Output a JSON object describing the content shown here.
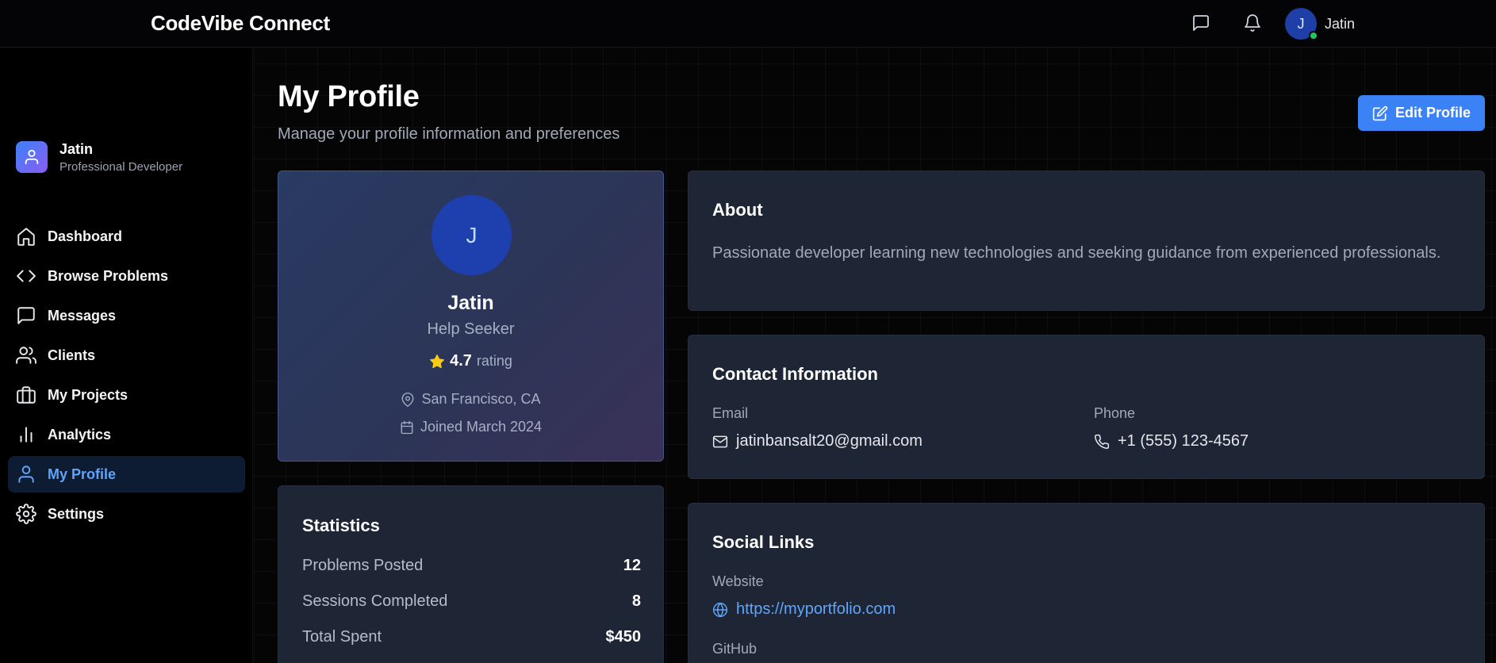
{
  "header": {
    "brand": "CodeVibe Connect",
    "avatar_initial": "J",
    "username": "Jatin",
    "icons": [
      "message-square-icon",
      "bell-icon"
    ]
  },
  "sidebar": {
    "user": {
      "name": "Jatin",
      "role": "Professional Developer"
    },
    "items": [
      {
        "label": "Dashboard",
        "icon": "home-icon"
      },
      {
        "label": "Browse Problems",
        "icon": "code-icon"
      },
      {
        "label": "Messages",
        "icon": "message-square-icon"
      },
      {
        "label": "Clients",
        "icon": "users-icon"
      },
      {
        "label": "My Projects",
        "icon": "briefcase-icon"
      },
      {
        "label": "Analytics",
        "icon": "bar-chart-icon"
      },
      {
        "label": "My Profile",
        "icon": "user-icon",
        "active": true
      },
      {
        "label": "Settings",
        "icon": "settings-icon"
      }
    ]
  },
  "main": {
    "title": "My Profile",
    "subtitle": "Manage your profile information and preferences",
    "edit_button": "Edit Profile"
  },
  "profile_card": {
    "initial": "J",
    "name": "Jatin",
    "role": "Help Seeker",
    "rating_value": "4.7",
    "rating_label": "rating",
    "location": "San Francisco, CA",
    "joined": "Joined March 2024"
  },
  "statistics": {
    "heading": "Statistics",
    "rows": [
      {
        "label": "Problems Posted",
        "value": "12"
      },
      {
        "label": "Sessions Completed",
        "value": "8"
      },
      {
        "label": "Total Spent",
        "value": "$450"
      }
    ]
  },
  "about": {
    "heading": "About",
    "text": "Passionate developer learning new technologies and seeking guidance from experienced professionals."
  },
  "contact": {
    "heading": "Contact Information",
    "email_label": "Email",
    "email": "jatinbansalt20@gmail.com",
    "phone_label": "Phone",
    "phone": "+1 (555) 123-4567"
  },
  "social": {
    "heading": "Social Links",
    "website_label": "Website",
    "website": "https://myportfolio.com",
    "github_label": "GitHub"
  },
  "colors": {
    "accent": "#3b82f6",
    "active_nav_bg": "#0d1b33",
    "card_bg": "#1e2636",
    "online": "#22c55e",
    "star": "#facc15"
  }
}
